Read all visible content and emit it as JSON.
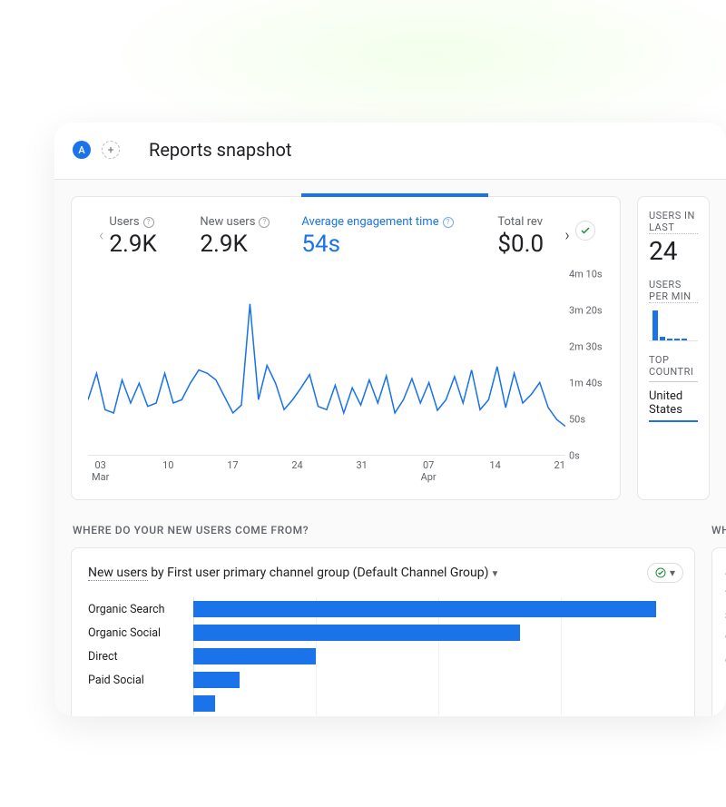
{
  "header": {
    "badge_letter": "A",
    "title": "Reports snapshot"
  },
  "metrics": [
    {
      "key": "users",
      "label": "Users",
      "value": "2.9K",
      "active": false
    },
    {
      "key": "newusers",
      "label": "New users",
      "value": "2.9K",
      "active": false
    },
    {
      "key": "avgeng",
      "label": "Average engagement time",
      "value": "54s",
      "active": true
    },
    {
      "key": "revenue",
      "label": "Total rev",
      "value": "$0.0",
      "active": false
    }
  ],
  "chart_data": {
    "type": "line",
    "title": "Average engagement time",
    "ylabel": "",
    "y_ticks": [
      "4m 10s",
      "3m 20s",
      "2m 30s",
      "1m 40s",
      "50s",
      "0s"
    ],
    "ylim_seconds": [
      0,
      250
    ],
    "x_ticks": [
      {
        "label": "03",
        "sub": "Mar"
      },
      {
        "label": "10",
        "sub": ""
      },
      {
        "label": "17",
        "sub": ""
      },
      {
        "label": "24",
        "sub": ""
      },
      {
        "label": "31",
        "sub": ""
      },
      {
        "label": "07",
        "sub": "Apr"
      },
      {
        "label": "14",
        "sub": ""
      },
      {
        "label": "21",
        "sub": ""
      }
    ],
    "values_seconds": [
      60,
      100,
      45,
      40,
      90,
      55,
      85,
      50,
      55,
      100,
      55,
      60,
      85,
      105,
      100,
      90,
      65,
      40,
      52,
      205,
      60,
      112,
      85,
      45,
      60,
      78,
      98,
      50,
      45,
      82,
      40,
      78,
      52,
      90,
      55,
      96,
      40,
      60,
      92,
      55,
      86,
      44,
      60,
      95,
      55,
      105,
      45,
      60,
      110,
      48,
      100,
      55,
      68,
      86,
      48,
      30,
      20
    ]
  },
  "realtime": {
    "label_last30": "USERS IN LAST",
    "value_last30": "24",
    "label_permin": "USERS PER MIN",
    "mini_bars_pct": [
      85,
      10,
      6,
      6,
      6
    ],
    "label_topcountries": "TOP COUNTRI",
    "top_country": "United States"
  },
  "section_newusers": {
    "heading": "WHERE DO YOUR NEW USERS COME FROM?",
    "title_prefix": "New users",
    "title_mid": " by ",
    "title_dim": "First user primary channel group (Default Channel Group)"
  },
  "bar_chart_data": {
    "type": "bar",
    "xlim": [
      0,
      1800
    ],
    "series": [
      {
        "name": "Organic Search",
        "value": 1700
      },
      {
        "name": "Organic Social",
        "value": 1200
      },
      {
        "name": "Direct",
        "value": 450
      },
      {
        "name": "Paid Social",
        "value": 170
      },
      {
        "name": "",
        "value": 80
      }
    ]
  },
  "section_right": {
    "heading": "WHAT",
    "head1": "S",
    "head2": "S",
    "sub": "SI",
    "rows": [
      "O",
      "O",
      "Di",
      "S"
    ]
  }
}
